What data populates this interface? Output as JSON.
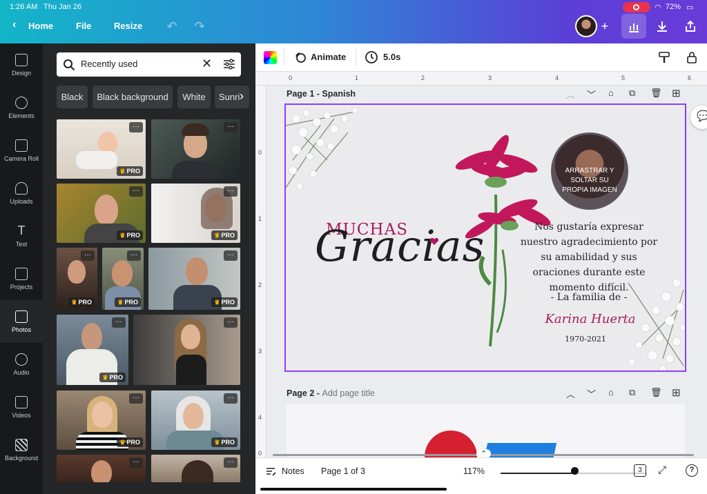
{
  "status": {
    "time": "1:26 AM",
    "date": "Thu Jan 26",
    "battery": "72%"
  },
  "nav": {
    "home": "Home",
    "file": "File",
    "resize": "Resize"
  },
  "rail": [
    {
      "label": "Design"
    },
    {
      "label": "Elements"
    },
    {
      "label": "Camera Roll"
    },
    {
      "label": "Uploads"
    },
    {
      "label": "Text"
    },
    {
      "label": "Projects"
    },
    {
      "label": "Photos"
    },
    {
      "label": "Audio"
    },
    {
      "label": "Videos"
    },
    {
      "label": "Background"
    }
  ],
  "search": {
    "query": "Recently used"
  },
  "chips": [
    "Black",
    "Black background",
    "White",
    "Sunri"
  ],
  "pro_label": "PRO",
  "more_label": "···",
  "toolbar": {
    "animate": "Animate",
    "duration": "5.0s"
  },
  "ruler": {
    "top": [
      "0",
      "1",
      "2",
      "3",
      "4",
      "5",
      "6"
    ],
    "left": [
      "0",
      "1",
      "2",
      "3",
      "4",
      "0"
    ]
  },
  "page1": {
    "prefix": "Page 1 - ",
    "title": "Spanish"
  },
  "page2": {
    "prefix": "Page 2 - ",
    "title": "Add page title"
  },
  "design": {
    "muchas": "MUCHAS",
    "gracias": "Gracias",
    "photo_placeholder": "ARRASTRAR Y SOLTAR SU PROPIA IMAGEN",
    "message": "Nos gustaría expresar nuestro agradecimiento por su amabilidad y sus oraciones durante este momento difícil.",
    "family": "- La familia de -",
    "name": "Karina Huerta",
    "years": "1970-2021"
  },
  "bottom": {
    "notes": "Notes",
    "page_indicator": "Page 1 of 3",
    "zoom": "117%",
    "page_count": "3"
  },
  "colors": {
    "accent": "#8b3dff",
    "magenta": "#b0185f",
    "rail_bg": "#18191b",
    "panel_bg": "#252627"
  }
}
